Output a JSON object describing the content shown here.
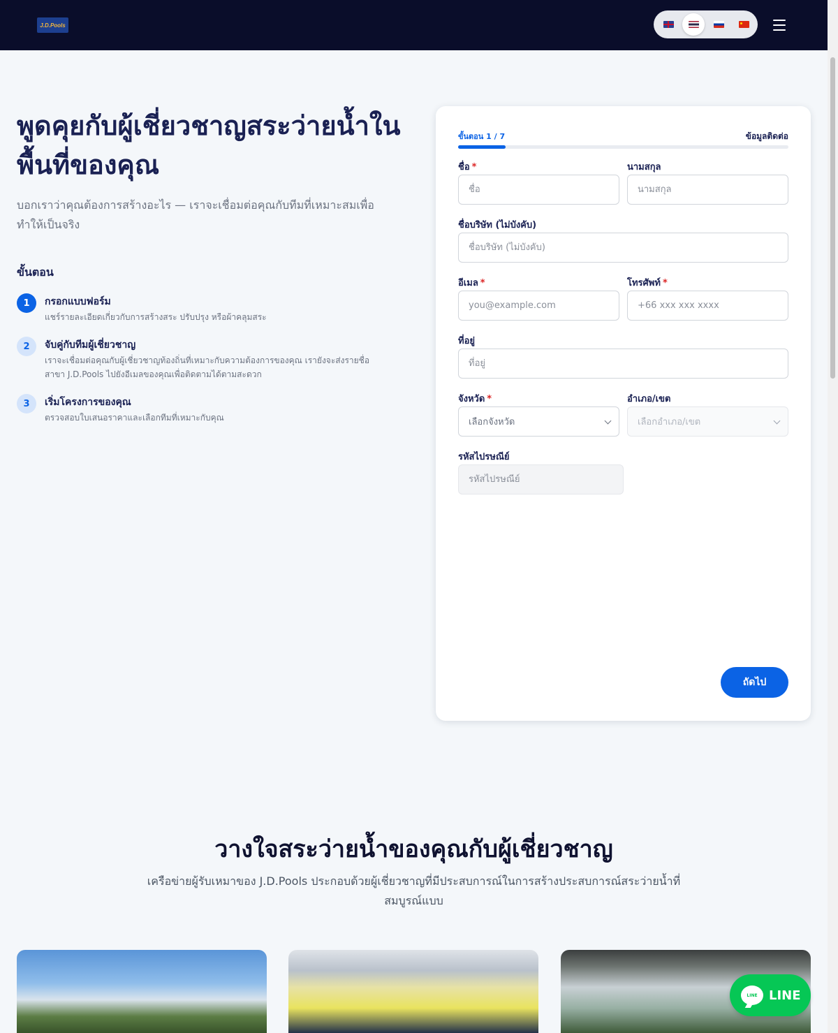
{
  "header": {
    "logo_text": "J.D.Pools",
    "languages": [
      {
        "code": "en",
        "flag": "flag-en-icon",
        "active": false
      },
      {
        "code": "th",
        "flag": "flag-th-icon",
        "active": true
      },
      {
        "code": "ru",
        "flag": "flag-ru-icon",
        "active": false
      },
      {
        "code": "cn",
        "flag": "flag-cn-icon",
        "active": false
      }
    ],
    "menu_icon": "hamburger-icon"
  },
  "hero": {
    "title": "พูดคุยกับผู้เชี่ยวชาญสระว่ายน้ำในพื้นที่ของคุณ",
    "subtitle": "บอกเราว่าคุณต้องการสร้างอะไร — เราจะเชื่อมต่อคุณกับทีมที่เหมาะสมเพื่อทำให้เป็นจริง",
    "steps_heading": "ขั้นตอน",
    "steps": [
      {
        "number": "1",
        "title": "กรอกแบบฟอร์ม",
        "description": "แชร์รายละเอียดเกี่ยวกับการสร้างสระ ปรับปรุง หรือผ้าคลุมสระ"
      },
      {
        "number": "2",
        "title": "จับคู่กับทีมผู้เชี่ยวชาญ",
        "description": "เราจะเชื่อมต่อคุณกับผู้เชี่ยวชาญท้องถิ่นที่เหมาะกับความต้องการของคุณ เรายังจะส่งรายชื่อสาขา J.D.Pools ไปยังอีเมลของคุณเพื่อติดตามได้ตามสะดวก"
      },
      {
        "number": "3",
        "title": "เริ่มโครงการของคุณ",
        "description": "ตรวจสอบใบเสนอราคาและเลือกทีมที่เหมาะกับคุณ"
      }
    ]
  },
  "form": {
    "progress_label": "ขั้นตอน 1 / 7",
    "progress_fraction": 0.143,
    "section_label": "ข้อมูลติดต่อ",
    "required_mark": "*",
    "fields": {
      "first_name": {
        "label": "ชื่อ",
        "placeholder": "ชื่อ"
      },
      "last_name": {
        "label": "นามสกุล",
        "placeholder": "นามสกุล"
      },
      "company": {
        "label": "ชื่อบริษัท (ไม่บังคับ)",
        "placeholder": "ชื่อบริษัท (ไม่บังคับ)"
      },
      "email": {
        "label": "อีเมล",
        "placeholder": "you@example.com"
      },
      "phone": {
        "label": "โทรศัพท์",
        "placeholder": "+66 xxx xxx xxxx"
      },
      "address": {
        "label": "ที่อยู่",
        "placeholder": "ที่อยู่"
      },
      "province": {
        "label": "จังหวัด",
        "placeholder": "เลือกจังหวัด"
      },
      "district": {
        "label": "อำเภอ/เขต",
        "placeholder": "เลือกอำเภอ/เขต"
      },
      "postal_code": {
        "label": "รหัสไปรษณีย์",
        "placeholder": "รหัสไปรษณีย์"
      }
    },
    "next_button": "ถัดไป"
  },
  "trust": {
    "title": "วางใจสระว่ายน้ำของคุณกับผู้เชี่ยวชาญ",
    "subtitle": "เครือข่ายผู้รับเหมาของ J.D.Pools ประกอบด้วยผู้เชี่ยวชาญที่มีประสบการณ์ในการสร้างประสบการณ์สระว่ายน้ำที่สมบูรณ์แบบ"
  },
  "line_widget": {
    "label": "LINE",
    "icon": "line-chat-icon",
    "brand_color": "#06c755"
  },
  "colors": {
    "primary": "#0b63e5",
    "navbar": "#0a0d2a",
    "heading": "#1a2153",
    "required": "#dc2626"
  }
}
